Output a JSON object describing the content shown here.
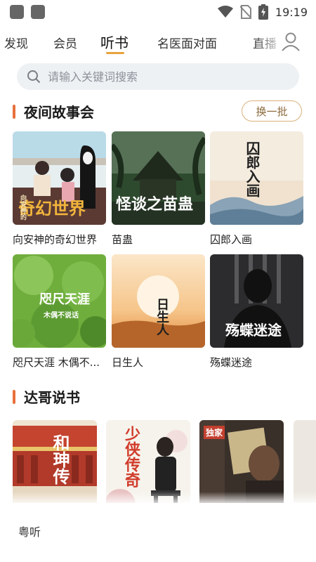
{
  "status_bar": {
    "time": "19:19",
    "icons": [
      "app-icon",
      "app-icon",
      "wifi-icon",
      "no-sim-icon",
      "battery-charging-icon"
    ]
  },
  "tabs": [
    {
      "label": "发现"
    },
    {
      "label": "会员"
    },
    {
      "label": "听书"
    },
    {
      "label": "名医面对面"
    },
    {
      "label": "直播"
    }
  ],
  "active_tab": "听书",
  "accent_color": "#e8a33c",
  "search": {
    "placeholder": "请输入关键词搜索"
  },
  "night_section": {
    "title": "夜间故事会",
    "refresh_label": "换一批",
    "items": [
      {
        "title": "向安神的奇幻世界",
        "cover_text": "奇幻世界",
        "cover_sub": "向安神的"
      },
      {
        "title": "苗蛊",
        "cover_text": "怪谈之苗蛊",
        "cover_sub": ""
      },
      {
        "title": "囚郎入画",
        "cover_text": "囚郎入画",
        "cover_sub": ""
      },
      {
        "title": "咫尺天涯 木偶不...",
        "cover_text": "咫尺天涯",
        "cover_sub": "木偶不说话"
      },
      {
        "title": "日生人",
        "cover_text": "日生人",
        "cover_sub": ""
      },
      {
        "title": "殇蝶迷途",
        "cover_text": "殇蝶迷途",
        "cover_sub": ""
      }
    ]
  },
  "dage_section": {
    "title": "达哥说书",
    "items": [
      {
        "cover_text": "和珅传"
      },
      {
        "cover_text": "少侠传奇"
      },
      {
        "cover_text": "独家"
      }
    ]
  },
  "bottom_bar": {
    "label": "粤听"
  }
}
